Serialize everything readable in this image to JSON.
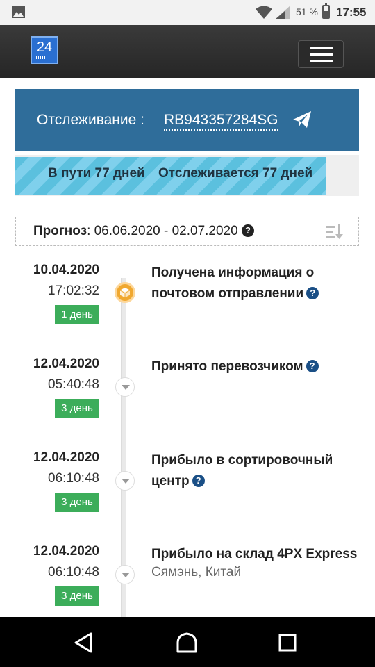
{
  "status_bar": {
    "battery_percent": "51 %",
    "time": "17:55",
    "icons": [
      "gallery-icon",
      "wifi-icon",
      "signal-icon",
      "battery-icon"
    ]
  },
  "app_bar": {
    "logo_text": "24",
    "menu_icon": "hamburger-icon"
  },
  "tracking": {
    "label": "Отслеживание :",
    "number": "RB943357284SG",
    "share_icon": "send-icon",
    "panel_color": "#2f6d9a"
  },
  "progress": {
    "in_transit": "В пути 77 дней",
    "tracked": "Отслеживается 77 дней",
    "fill_fraction": 0.903,
    "color": "#5bc0de"
  },
  "forecast": {
    "label": "Прогноз",
    "value": ": 06.06.2020 - 02.07.2020",
    "help_icon": "question-icon",
    "sort_icon": "sort-icon"
  },
  "events": [
    {
      "date": "10.04.2020",
      "time": "17:02:32",
      "badge": "1 день",
      "title": "Получена информация о почтовом отправлении",
      "subtitle": "",
      "help": true
    },
    {
      "date": "12.04.2020",
      "time": "05:40:48",
      "badge": "3 день",
      "title": "Принято перевозчиком",
      "subtitle": "",
      "help": true
    },
    {
      "date": "12.04.2020",
      "time": "06:10:48",
      "badge": "3 день",
      "title": "Прибыло в сортировочный центр",
      "subtitle": "",
      "help": true
    },
    {
      "date": "12.04.2020",
      "time": "06:10:48",
      "badge": "3 день",
      "title": "Прибыло на склад 4PX Express",
      "subtitle": "Сямэнь, Китай",
      "help": false
    }
  ],
  "nav_bar": {
    "icons": [
      "back-icon",
      "home-icon",
      "recent-apps-icon"
    ]
  }
}
